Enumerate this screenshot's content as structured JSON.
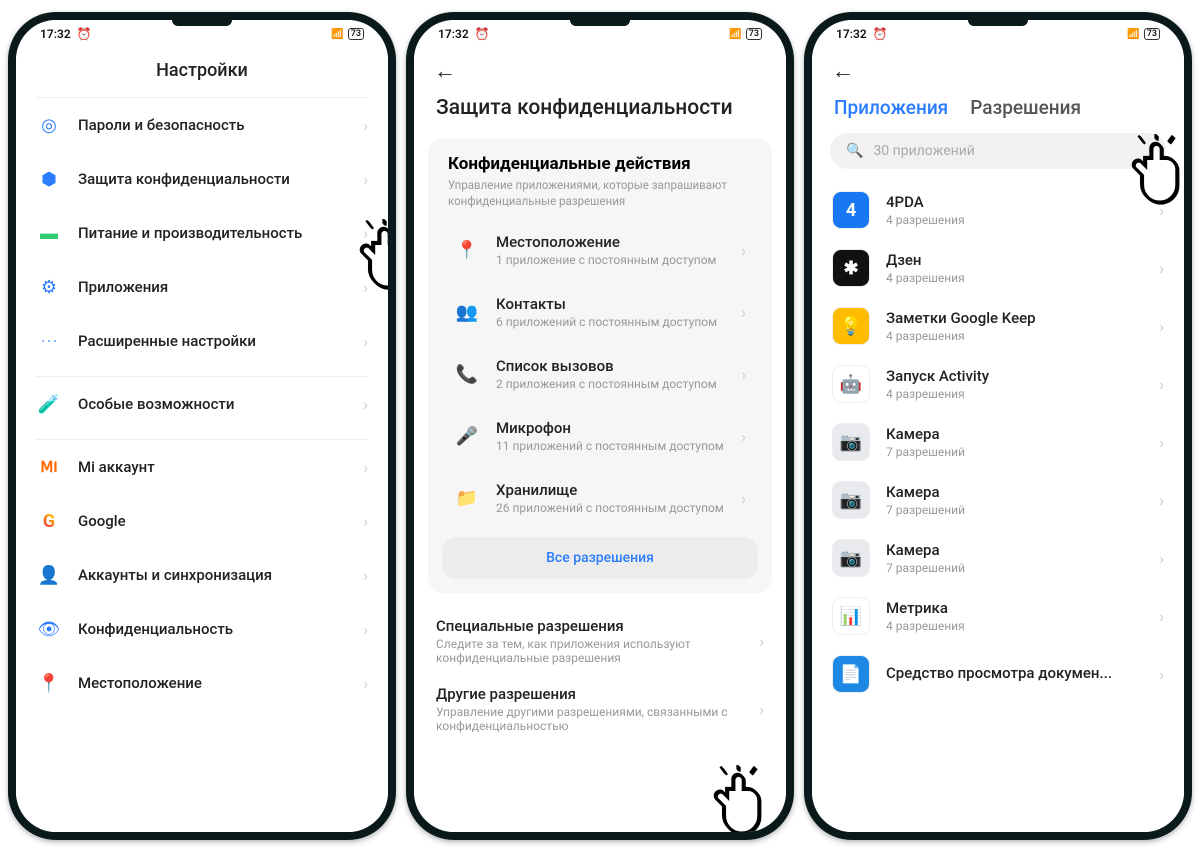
{
  "status": {
    "time": "17:32",
    "battery": "73"
  },
  "p1": {
    "title": "Настройки",
    "items": [
      {
        "label": "Пароли и безопасность"
      },
      {
        "label": "Защита конфиденциальности"
      },
      {
        "label": "Питание и производительность"
      },
      {
        "label": "Приложения"
      },
      {
        "label": "Расширенные настройки"
      }
    ],
    "access": {
      "label": "Особые возможности"
    },
    "accounts": [
      {
        "label": "Mi аккаунт"
      },
      {
        "label": "Google"
      },
      {
        "label": "Аккаунты и синхронизация"
      },
      {
        "label": "Конфиденциальность"
      },
      {
        "label": "Местоположение"
      }
    ]
  },
  "p2": {
    "title": "Защита конфиденциальности",
    "card": {
      "title": "Конфиденциальные действия",
      "sub": "Управление приложениями, которые запрашивают конфиденциальные разрешения",
      "rows": [
        {
          "label": "Местоположение",
          "sub": "1 приложение с постоянным доступом"
        },
        {
          "label": "Контакты",
          "sub": "6 приложений с постоянным доступом"
        },
        {
          "label": "Список вызовов",
          "sub": "2 приложения с постоянным доступом"
        },
        {
          "label": "Микрофон",
          "sub": "11 приложений с постоянным доступом"
        },
        {
          "label": "Хранилище",
          "sub": "26 приложений с постоянным доступом"
        }
      ],
      "all": "Все разрешения"
    },
    "rows2": [
      {
        "label": "Специальные разрешения",
        "sub": "Следите за тем, как приложения используют конфиденциальные разрешения"
      },
      {
        "label": "Другие разрешения",
        "sub": "Управление другими разрешениями, связанными с конфиденциальностью"
      }
    ]
  },
  "p3": {
    "tabs": {
      "apps": "Приложения",
      "perms": "Разрешения"
    },
    "search": "30 приложений",
    "apps": [
      {
        "label": "4PDA",
        "sub": "4 разрешения",
        "bg": "#1877f2",
        "txt": "4"
      },
      {
        "label": "Дзен",
        "sub": "4 разрешения",
        "bg": "#111",
        "txt": "✱"
      },
      {
        "label": "Заметки Google Keep",
        "sub": "4 разрешения",
        "bg": "#ffbc00",
        "txt": "💡"
      },
      {
        "label": "Запуск Activity",
        "sub": "4 разрешения",
        "bg": "#fff",
        "txt": "🤖"
      },
      {
        "label": "Камера",
        "sub": "7 разрешений",
        "bg": "#e8eaed",
        "txt": "📷"
      },
      {
        "label": "Камера",
        "sub": "7 разрешений",
        "bg": "#e8eaed",
        "txt": "📷"
      },
      {
        "label": "Камера",
        "sub": "7 разрешений",
        "bg": "#e8eaed",
        "txt": "📷"
      },
      {
        "label": "Метрика",
        "sub": "4 разрешения",
        "bg": "#fff",
        "txt": "📊"
      },
      {
        "label": "Средство просмотра докумен...",
        "sub": "",
        "bg": "#1e88e5",
        "txt": "📄"
      }
    ]
  }
}
